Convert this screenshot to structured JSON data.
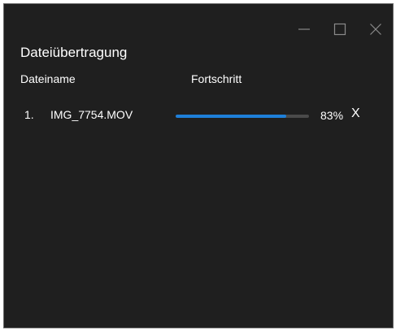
{
  "window": {
    "title": "Dateiübertragung",
    "controls": [
      "minimize-icon",
      "maximize-icon",
      "close-icon"
    ]
  },
  "table": {
    "columns": {
      "name": "Dateiname",
      "progress": "Fortschritt"
    },
    "rows": [
      {
        "index": "1.",
        "file": "IMG_7754.MOV",
        "progress": 0.83,
        "percent_label": "83%",
        "cancel_label": "X"
      }
    ]
  },
  "colors": {
    "background": "#1f1f1f",
    "progress_fill": "#1e7fd9",
    "progress_track": "#4a4a4a"
  }
}
